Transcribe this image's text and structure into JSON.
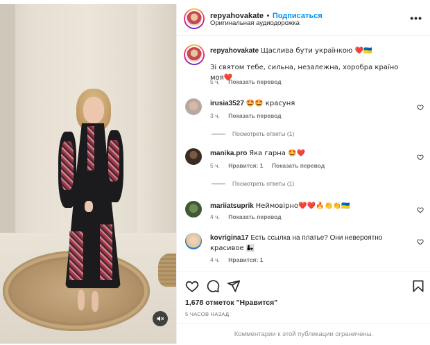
{
  "post": {
    "author": "repyahovakate",
    "separator": "•",
    "follow_label": "Подписаться",
    "audio": "Оригинальная аудиодорожка",
    "more_icon": "more-horizontal-icon"
  },
  "caption": {
    "username": "repyahovakate",
    "text_line1": "Щаслива бути українкою ❤️🇺🇦",
    "text_line2": "Зі святом тебе, сильна, незалежна, хоробра країно моя❤️",
    "time": "5 ч.",
    "translate": "Показать перевод"
  },
  "comments": [
    {
      "username": "irusia3527",
      "text": "🤩🤩 красуня",
      "time": "3 ч.",
      "likes": "",
      "translate": "Показать перевод",
      "replies": "Посмотреть ответы (1)"
    },
    {
      "username": "manika.pro",
      "text": "Яка гарна 🤩❤️",
      "time": "5 ч.",
      "likes": "Нравится: 1",
      "translate": "Показать перевод",
      "replies": "Посмотреть ответы (1)"
    },
    {
      "username": "mariiatsuprik",
      "text": "Неймовірно❤️❤️🔥👏👏🇺🇦",
      "time": "4 ч.",
      "likes": "",
      "translate": "Показать перевод",
      "replies": ""
    },
    {
      "username": "kovrigina17",
      "text_line1": "Есть ссылка на платье? Они невероятно",
      "text_line2": "красивое 👩‍👧",
      "time": "4 ч.",
      "likes": "Нравится: 1",
      "translate": "",
      "replies": ""
    }
  ],
  "actions": {
    "like_icon": "heart-icon",
    "comment_icon": "comment-icon",
    "share_icon": "send-icon",
    "save_icon": "bookmark-icon"
  },
  "likes_text": "1,678 отметок \"Нравится\"",
  "posted_time": "5 ЧАСОВ НАЗАД",
  "footer_text": "Комментарии к этой публикации ограничены.",
  "media": {
    "mute_icon": "speaker-muted-icon"
  },
  "colors": {
    "accent": "#0095f6",
    "text": "#262626",
    "muted": "#737373",
    "heart_red": "#ed4956"
  }
}
